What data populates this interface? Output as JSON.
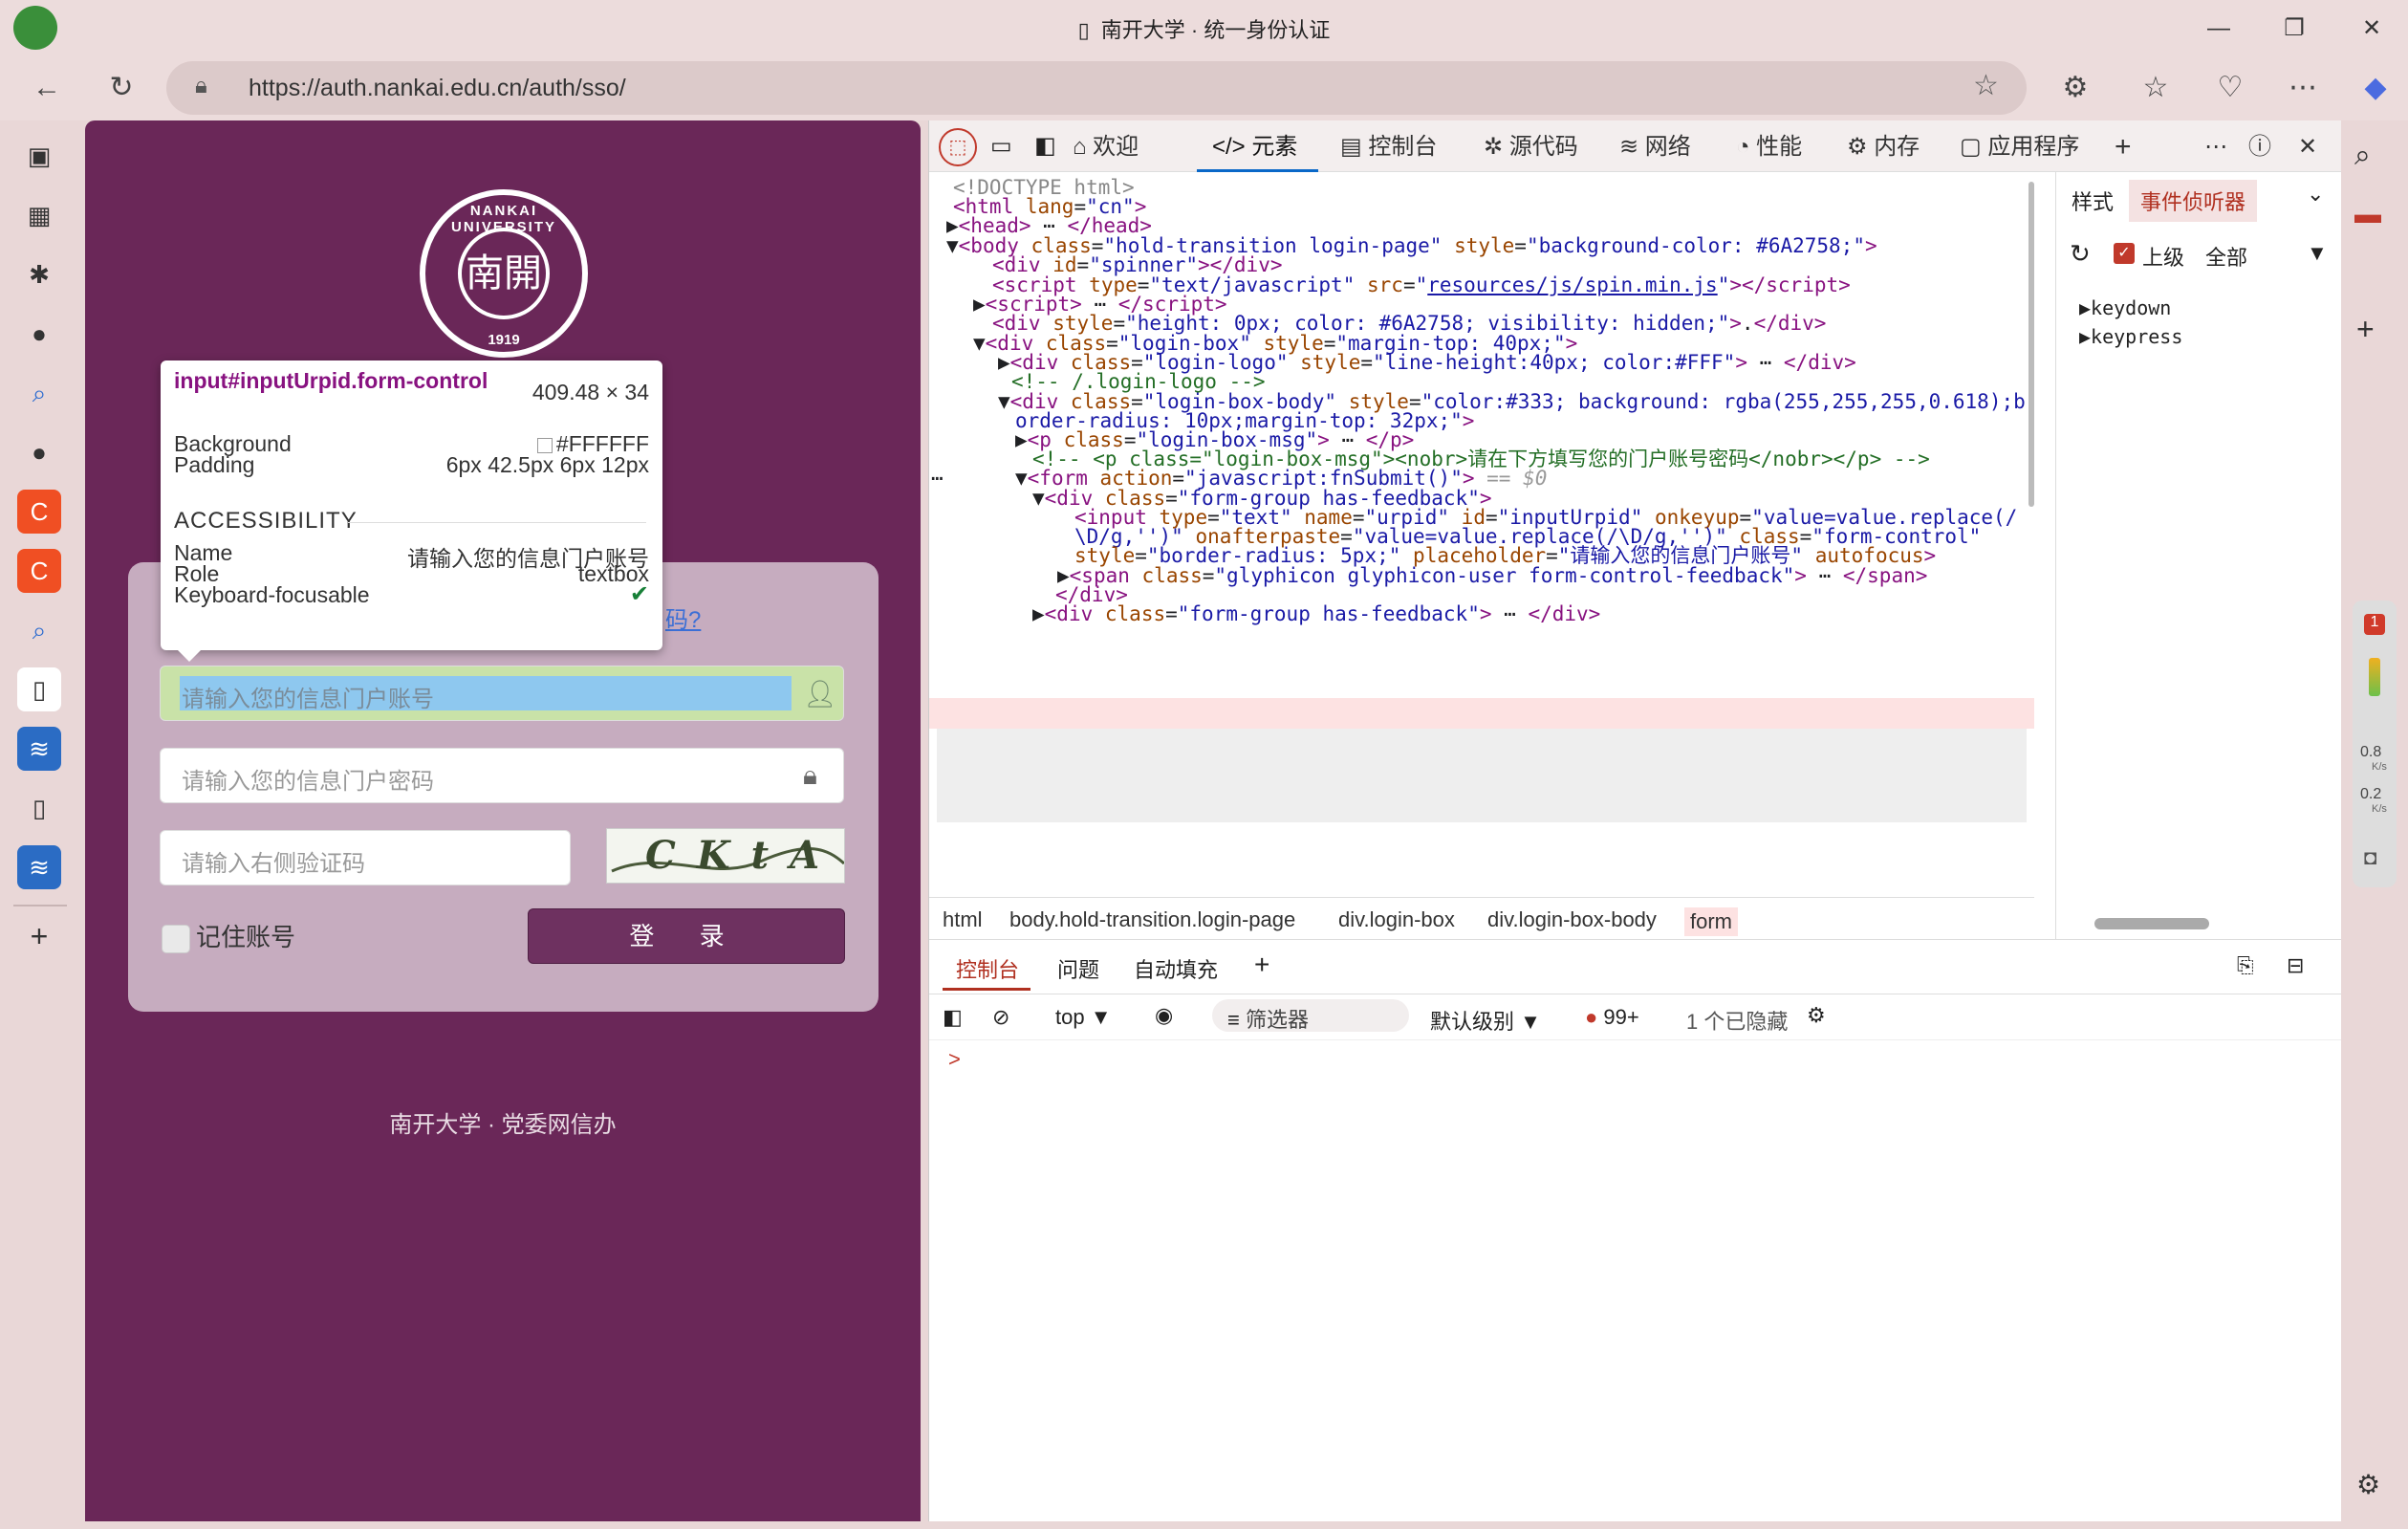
{
  "window": {
    "title": "南开大学 · 统一身份认证",
    "minimize": "—",
    "maximize": "❐",
    "close": "✕"
  },
  "address_bar": {
    "url": "https://auth.nankai.edu.cn/auth/sso/"
  },
  "sidebar_icons": [
    "tabs-icon",
    "image-icon",
    "extension-icon",
    "github-icon",
    "search-icon",
    "github-icon",
    "c-icon",
    "c-icon",
    "search-icon",
    "page-icon",
    "app-icon",
    "page-icon",
    "app-icon",
    "add-icon"
  ],
  "login": {
    "logo_ring": "NANKAI UNIVERSITY",
    "logo_center": "南開",
    "logo_year": "1919",
    "forgot_fragment": "码?",
    "username_placeholder": "请输入您的信息门户账号",
    "password_placeholder": "请输入您的信息门户密码",
    "captcha_placeholder": "请输入右侧验证码",
    "captcha_text": "CKtA",
    "remember_label": "记住账号",
    "login_button": "登 录",
    "footer": "南开大学 · 党委网信办"
  },
  "tooltip": {
    "selector": "input#inputUrpid.form-control",
    "size": "409.48 × 34",
    "background_label": "Background",
    "background_value": "#FFFFFF",
    "padding_label": "Padding",
    "padding_value": "6px 42.5px 6px 12px",
    "accessibility_title": "ACCESSIBILITY",
    "name_label": "Name",
    "name_value": "请输入您的信息门户账号",
    "role_label": "Role",
    "role_value": "textbox",
    "focusable_label": "Keyboard-focusable"
  },
  "devtools": {
    "tabs": [
      "欢迎",
      "元素",
      "控制台",
      "源代码",
      "网络",
      "性能",
      "内存",
      "应用程序"
    ],
    "side_tabs": [
      "样式",
      "事件侦听器"
    ],
    "side_filter_label": "上级",
    "side_filter_value": "全部",
    "listeners": [
      "keydown",
      "keypress"
    ],
    "breadcrumbs": [
      "html",
      "body.hold-transition.login-page",
      "div.login-box",
      "div.login-box-body",
      "form"
    ],
    "drawer_tabs": [
      "控制台",
      "问题",
      "自动填充"
    ],
    "console_toolbar": {
      "context": "top",
      "filter_placeholder": "筛选器",
      "level": "默认级别",
      "issues": "99+",
      "hidden": "1 个已隐藏"
    },
    "console_prompt": ">"
  },
  "right_bar": {
    "net_up": "0.8",
    "net_down": "0.2",
    "unit": "K/s",
    "badge": "1"
  },
  "colors": {
    "page_bg": "#6a2758",
    "accent": "#0a68c8"
  }
}
